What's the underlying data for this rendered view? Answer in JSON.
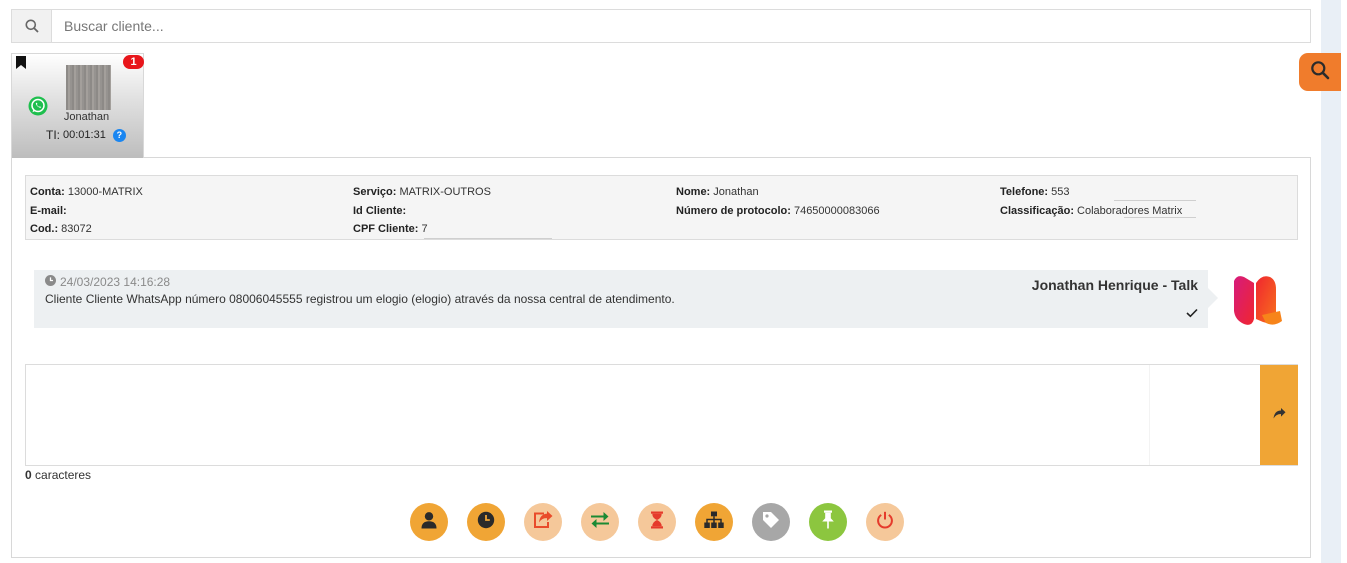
{
  "search": {
    "placeholder": "Buscar cliente..."
  },
  "tab": {
    "badge_count": "1",
    "client_name": "Jonathan",
    "ti_label": "TI:",
    "ti_value": "00:01:31",
    "help_glyph": "?",
    "channel_icon": "whatsapp-icon"
  },
  "info": {
    "conta_label": "Conta:",
    "conta_value": "13000-MATRIX",
    "email_label": "E-mail:",
    "email_value": "",
    "cod_label": "Cod.:",
    "cod_value": "83072",
    "servico_label": "Serviço:",
    "servico_value": "MATRIX-OUTROS",
    "idcliente_label": "Id Cliente:",
    "idcliente_value": "",
    "cpf_label": "CPF Cliente:",
    "cpf_value": "7",
    "nome_label": "Nome:",
    "nome_value": "Jonathan",
    "protocolo_label": "Número de protocolo:",
    "protocolo_value": "74650000083066",
    "telefone_label": "Telefone:",
    "telefone_value": "553",
    "classificacao_label": "Classificação:",
    "classificacao_value": "Colaboradores Matrix"
  },
  "message": {
    "timestamp": "24/03/2023 14:16:28",
    "text": "Cliente Cliente WhatsApp número 08006045555 registrou um elogio (elogio) através da nossa central de atendimento.",
    "author": "Jonathan Henrique - Talk"
  },
  "composer": {
    "char_count": "0",
    "char_label": " caracteres"
  },
  "actions": [
    {
      "name": "client-info-button",
      "icon": "user-icon",
      "color": "#f0a535"
    },
    {
      "name": "history-button",
      "icon": "clock-icon",
      "color": "#f0a535"
    },
    {
      "name": "forward-button",
      "icon": "share-icon",
      "color": "#f5c89a"
    },
    {
      "name": "transfer-button",
      "icon": "exchange-icon",
      "color": "#f5c89a"
    },
    {
      "name": "wait-button",
      "icon": "hourglass-icon",
      "color": "#f5c89a"
    },
    {
      "name": "department-button",
      "icon": "sitemap-icon",
      "color": "#f0a535"
    },
    {
      "name": "tag-button",
      "icon": "tag-icon",
      "color": "#a7a7a7"
    },
    {
      "name": "pin-button",
      "icon": "pin-icon",
      "color": "#8cc63f"
    },
    {
      "name": "end-chat-button",
      "icon": "power-icon",
      "color": "#f5c89a"
    }
  ]
}
